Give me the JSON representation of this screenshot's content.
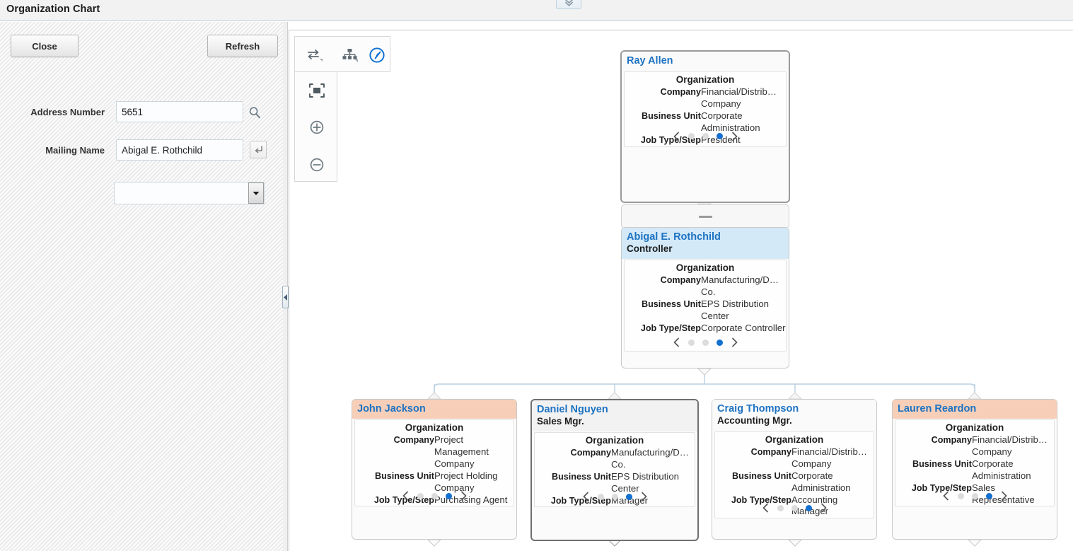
{
  "window": {
    "title": "Organization Chart",
    "collapse_all_icon": "chevron-double-down-icon"
  },
  "left_panel": {
    "close_label": "Close",
    "refresh_label": "Refresh",
    "fields": [
      {
        "label": "Address Number",
        "value": "5651",
        "placeholder": ""
      },
      {
        "label": "Mailing Name",
        "value": "Abigal E. Rothchild",
        "placeholder": ""
      }
    ],
    "search_icon": "magnifier-icon",
    "visual_assist_icon": "enter-arrow-icon",
    "org_select": {
      "value": "",
      "placeholder": "",
      "arrow_icon": "chevron-down-icon"
    },
    "splitter_icon": "collapse-left-icon"
  },
  "toolbar": {
    "items": [
      {
        "name": "layout-orientation-icon",
        "tooltip": "Layout"
      },
      {
        "name": "hierarchy-icon",
        "tooltip": "Hierarchy"
      },
      {
        "name": "navigator-compass-icon",
        "tooltip": "Navigator"
      },
      {
        "name": "fit-to-screen-icon",
        "tooltip": "Fit to Screen"
      },
      {
        "name": "zoom-in-icon",
        "tooltip": "Zoom In"
      },
      {
        "name": "zoom-out-icon",
        "tooltip": "Zoom Out"
      }
    ]
  },
  "chart": {
    "body_title": "Organization",
    "keys": {
      "company": "Company",
      "business_unit": "Business Unit",
      "job": "Job Type/Step"
    },
    "pager": {
      "prev_icon": "chevron-left-icon",
      "next_icon": "chevron-right-icon",
      "dots": 3,
      "active_index": 2
    },
    "stub": {
      "indicator": "collapse-dash-icon"
    },
    "nodes": {
      "root": {
        "name": "Ray Allen",
        "title": "",
        "company": "Financial/Distrib… Company",
        "business_unit": "Corporate Administration",
        "job": "President",
        "header_style": "white"
      },
      "selected": {
        "name": "Abigal E. Rothchild",
        "title": "Controller",
        "company": "Manufacturing/D… Co.",
        "business_unit": "EPS Distribution Center",
        "job": "Corporate Controller",
        "header_style": "blue"
      },
      "children": [
        {
          "name": "John Jackson",
          "title": "",
          "company": "Project Management Company",
          "business_unit": "Project Holding Company",
          "job": "Purchasing Agent",
          "header_style": "peach"
        },
        {
          "name": "Daniel Nguyen",
          "title": "Sales Mgr.",
          "company": "Manufacturing/D… Co.",
          "business_unit": "EPS Distribution Center",
          "job": "Manager",
          "header_style": "gray"
        },
        {
          "name": "Craig Thompson",
          "title": "Accounting Mgr.",
          "company": "Financial/Distrib… Company",
          "business_unit": "Corporate Administration",
          "job": "Accounting Manager",
          "header_style": "white"
        },
        {
          "name": "Lauren Reardon",
          "title": "",
          "company": "Financial/Distrib… Company",
          "business_unit": "Corporate Administration",
          "job": "Sales Representative",
          "header_style": "peach"
        }
      ]
    }
  },
  "colors": {
    "accent_blue": "#1d72c2",
    "header_blue": "#d3e9f8",
    "header_peach": "#f7cfb8",
    "pager_active": "#1370d0",
    "connector": "#b8cfe0"
  }
}
